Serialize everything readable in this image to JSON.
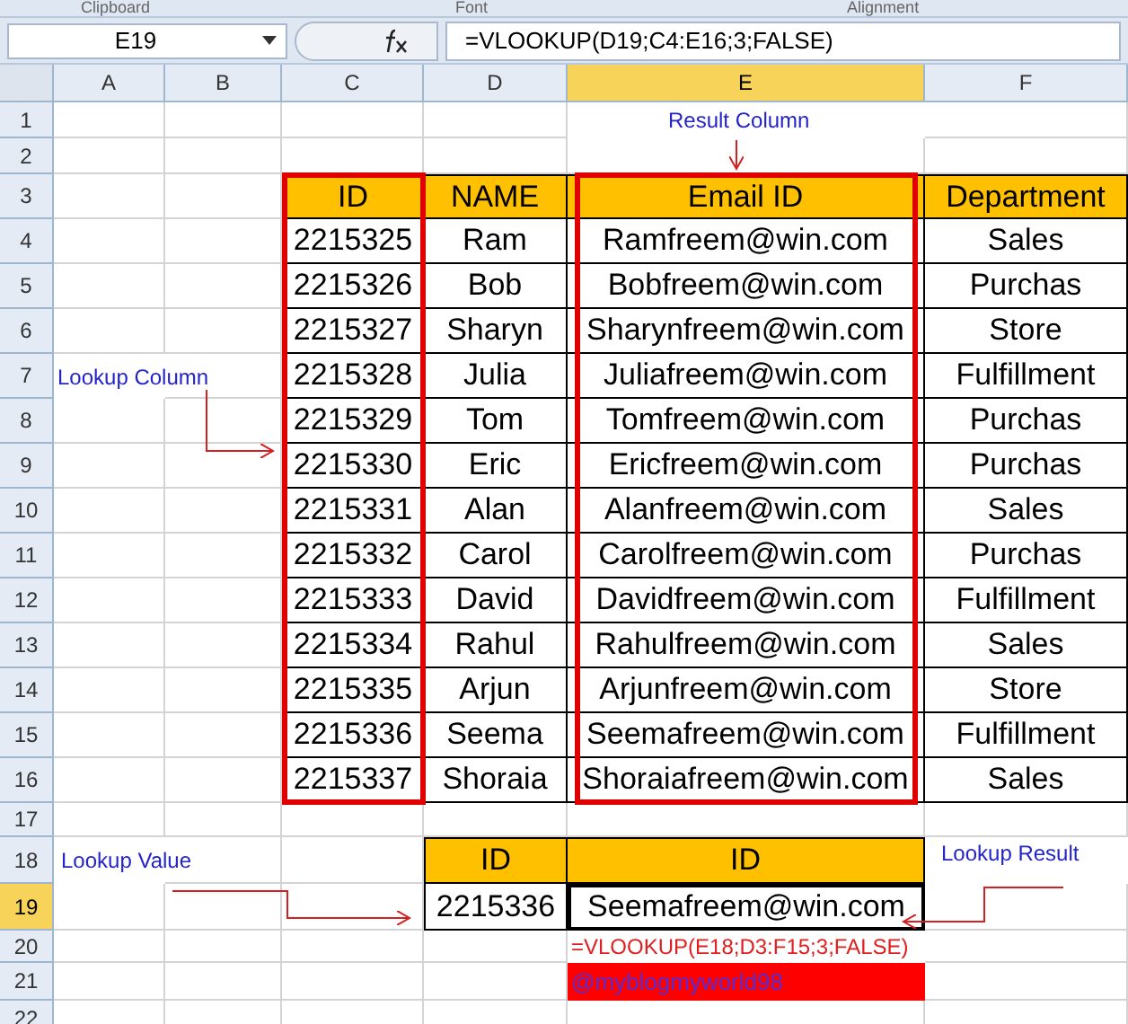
{
  "ribbon_groups": [
    "Clipboard",
    "Font",
    "Alignment"
  ],
  "formula_bar": {
    "name_box": "E19",
    "formula": "=VLOOKUP(D19;C4:E16;3;FALSE)"
  },
  "columns": [
    {
      "label": "A",
      "selected": false
    },
    {
      "label": "B",
      "selected": false
    },
    {
      "label": "C",
      "selected": false
    },
    {
      "label": "D",
      "selected": false
    },
    {
      "label": "E",
      "selected": true
    },
    {
      "label": "F",
      "selected": false
    }
  ],
  "row_numbers": [
    {
      "label": "1",
      "selected": false
    },
    {
      "label": "2",
      "selected": false
    },
    {
      "label": "3",
      "selected": false
    },
    {
      "label": "4",
      "selected": false
    },
    {
      "label": "5",
      "selected": false
    },
    {
      "label": "6",
      "selected": false
    },
    {
      "label": "7",
      "selected": false
    },
    {
      "label": "8",
      "selected": false
    },
    {
      "label": "9",
      "selected": false
    },
    {
      "label": "10",
      "selected": false
    },
    {
      "label": "11",
      "selected": false
    },
    {
      "label": "12",
      "selected": false
    },
    {
      "label": "13",
      "selected": false
    },
    {
      "label": "14",
      "selected": false
    },
    {
      "label": "15",
      "selected": false
    },
    {
      "label": "16",
      "selected": false
    },
    {
      "label": "17",
      "selected": false
    },
    {
      "label": "18",
      "selected": false
    },
    {
      "label": "19",
      "selected": true
    },
    {
      "label": "20",
      "selected": false
    },
    {
      "label": "21",
      "selected": false
    },
    {
      "label": "22",
      "selected": false
    }
  ],
  "main_table": {
    "columns": [
      "ID",
      "NAME",
      "Email ID",
      "Department"
    ],
    "rows": [
      [
        "2215325",
        "Ram",
        "Ramfreem@win.com",
        "Sales"
      ],
      [
        "2215326",
        "Bob",
        "Bobfreem@win.com",
        "Purchas"
      ],
      [
        "2215327",
        "Sharyn",
        "Sharynfreem@win.com",
        "Store"
      ],
      [
        "2215328",
        "Julia",
        "Juliafreem@win.com",
        "Fulfillment"
      ],
      [
        "2215329",
        "Tom",
        "Tomfreem@win.com",
        "Purchas"
      ],
      [
        "2215330",
        "Eric",
        "Ericfreem@win.com",
        "Purchas"
      ],
      [
        "2215331",
        "Alan",
        "Alanfreem@win.com",
        "Sales"
      ],
      [
        "2215332",
        "Carol",
        "Carolfreem@win.com",
        "Purchas"
      ],
      [
        "2215333",
        "David",
        "Davidfreem@win.com",
        "Fulfillment"
      ],
      [
        "2215334",
        "Rahul",
        "Rahulfreem@win.com",
        "Sales"
      ],
      [
        "2215335",
        "Arjun",
        "Arjunfreem@win.com",
        "Store"
      ],
      [
        "2215336",
        "Seema",
        "Seemafreem@win.com",
        "Fulfillment"
      ],
      [
        "2215337",
        "Shoraia",
        "Shoraiafreem@win.com",
        "Sales"
      ]
    ]
  },
  "lookup_table": {
    "columns": [
      "ID",
      "ID"
    ],
    "row": [
      "2215336",
      "Seemafreem@win.com"
    ]
  },
  "annotations": {
    "result_column": "Result Column",
    "lookup_column": "Lookup Column",
    "lookup_value": "Lookup Value",
    "lookup_result": "Lookup Result"
  },
  "formula_note": "=VLOOKUP(E18;D3:F15;3;FALSE)",
  "tag_cell": "@myblogmyworld98"
}
